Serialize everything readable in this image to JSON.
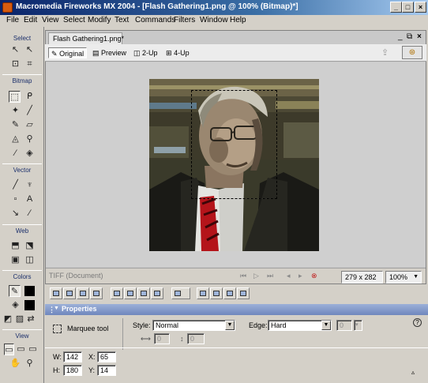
{
  "window": {
    "title": "Macromedia Fireworks MX 2004 - [Flash Gathering1.png @ 100% (Bitmap)*]",
    "controls": {
      "minimize": "_",
      "maximize": "□",
      "close": "×"
    }
  },
  "menubar": {
    "items": [
      "File",
      "Edit",
      "View",
      "Select",
      "Modify",
      "Text",
      "Commands",
      "Filters",
      "Window",
      "Help"
    ]
  },
  "tools": {
    "sections": {
      "select": "Select",
      "bitmap": "Bitmap",
      "vector": "Vector",
      "web": "Web",
      "colors": "Colors",
      "view": "View"
    }
  },
  "document": {
    "tab_label": "Flash Gathering1.png*",
    "view_tabs": [
      "Original",
      "Preview",
      "2-Up",
      "4-Up"
    ],
    "selected_view": "Original",
    "status_left": "TIFF (Document)",
    "dimensions": "279 x 282",
    "zoom": "100%",
    "colors": {
      "accent": "#0a246a",
      "panel_title": "#6f87bd"
    }
  },
  "properties": {
    "title": "Properties",
    "tool_name": "Marquee tool",
    "style_label": "Style:",
    "style_value": "Normal",
    "edge_label": "Edge:",
    "edge_value": "Hard",
    "edge_amount": "0",
    "ratio_w": "0",
    "ratio_h": "0",
    "w_label": "W:",
    "w_value": "142",
    "x_label": "X:",
    "x_value": "65",
    "h_label": "H:",
    "h_value": "180",
    "y_label": "Y:",
    "y_value": "14"
  }
}
